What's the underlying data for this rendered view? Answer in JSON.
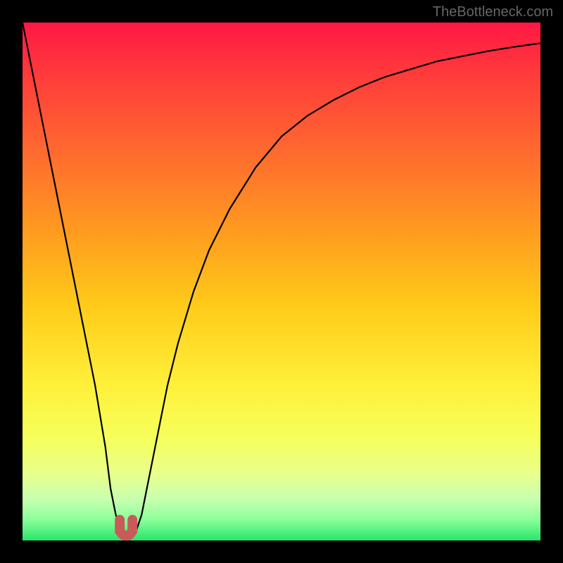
{
  "watermark": "TheBottleneck.com",
  "chart_data": {
    "type": "line",
    "title": "",
    "xlabel": "",
    "ylabel": "",
    "xlim": [
      0,
      100
    ],
    "ylim": [
      0,
      100
    ],
    "gradient_stops": [
      {
        "pos": 0.0,
        "color": "#ff1744"
      },
      {
        "pos": 0.1,
        "color": "#ff3b3b"
      },
      {
        "pos": 0.25,
        "color": "#ff6a2f"
      },
      {
        "pos": 0.4,
        "color": "#ff9a1f"
      },
      {
        "pos": 0.55,
        "color": "#ffcc1a"
      },
      {
        "pos": 0.7,
        "color": "#fff03a"
      },
      {
        "pos": 0.8,
        "color": "#f6ff5a"
      },
      {
        "pos": 0.87,
        "color": "#e9ff8a"
      },
      {
        "pos": 0.92,
        "color": "#c8ffb0"
      },
      {
        "pos": 0.96,
        "color": "#8aff9a"
      },
      {
        "pos": 1.0,
        "color": "#26e66a"
      }
    ],
    "series": [
      {
        "name": "curve",
        "x": [
          0,
          2,
          4,
          6,
          8,
          10,
          12,
          14,
          16,
          17,
          18,
          19,
          20,
          21,
          22,
          23,
          24,
          26,
          28,
          30,
          33,
          36,
          40,
          45,
          50,
          55,
          60,
          65,
          70,
          75,
          80,
          85,
          90,
          95,
          100
        ],
        "y": [
          100,
          90,
          80,
          70,
          60,
          50,
          40,
          30,
          18,
          10,
          5,
          2,
          1,
          1,
          2,
          5,
          10,
          20,
          30,
          38,
          48,
          56,
          64,
          72,
          78,
          82,
          85,
          87.5,
          89.5,
          91,
          92.5,
          93.5,
          94.5,
          95.3,
          96
        ]
      }
    ],
    "marker": {
      "name": "cusp-marker",
      "type": "u-shape",
      "color": "#c95a5a",
      "x": 20,
      "y": 1
    }
  }
}
